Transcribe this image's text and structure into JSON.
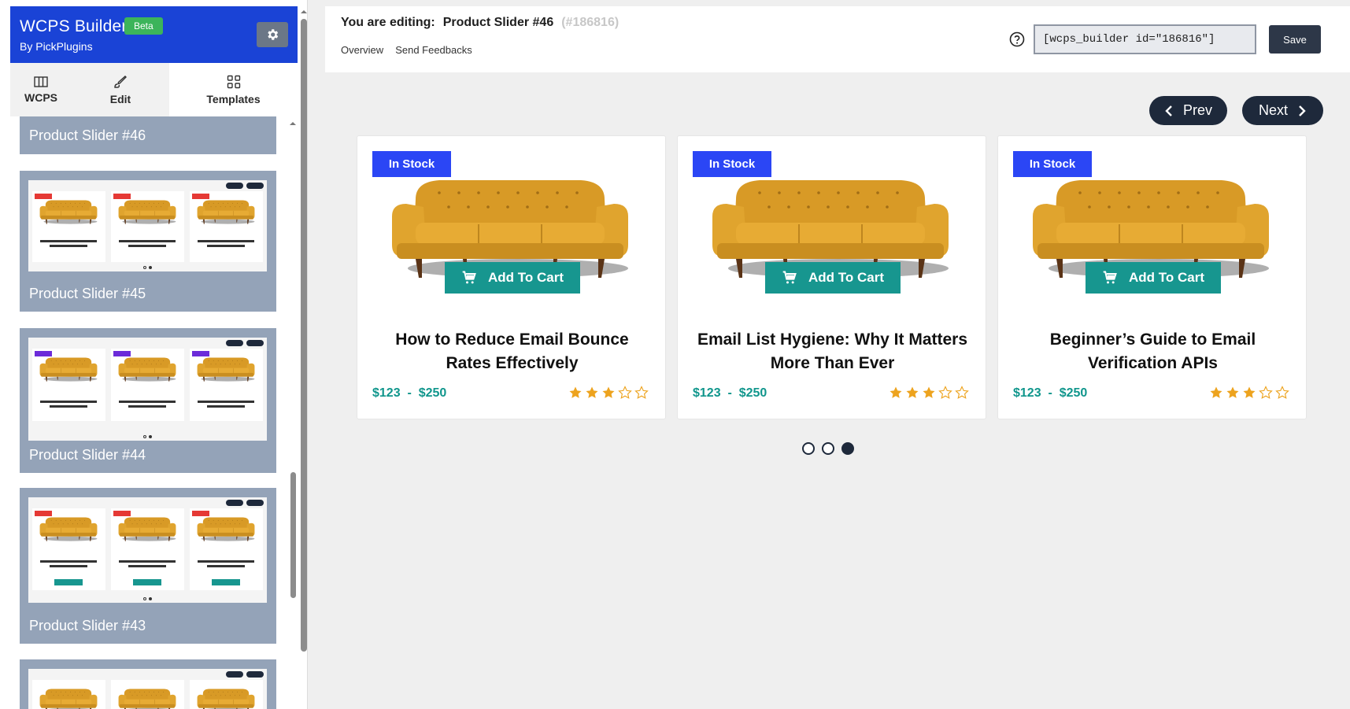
{
  "sidebar": {
    "title": "WCPS Builder",
    "badge": "Beta",
    "subtitle": "By PickPlugins",
    "tabs": [
      {
        "label": "WCPS",
        "icon": "columns-icon"
      },
      {
        "label": "Edit",
        "icon": "brush-icon"
      },
      {
        "label": "Templates",
        "icon": "grid-icon"
      }
    ],
    "active_tab": "Templates",
    "templates": [
      {
        "label": "Product Slider #46"
      },
      {
        "label": "Product Slider #45"
      },
      {
        "label": "Product Slider #44"
      },
      {
        "label": "Product Slider #43"
      },
      {
        "label": ""
      }
    ]
  },
  "topbar": {
    "editing_prefix": "You are editing:",
    "editing_name": "Product Slider #46",
    "editing_id": "(#186816)",
    "links": [
      "Overview",
      "Send Feedbacks"
    ],
    "shortcode": "[wcps_builder id=\"186816\"]",
    "save_label": "Save"
  },
  "slider": {
    "prev_label": "Prev",
    "next_label": "Next",
    "products": [
      {
        "badge": "In Stock",
        "cart_label": "Add To Cart",
        "title": "How to Reduce Email Bounce Rates Effectively",
        "price": "$123  -  $250",
        "rating": 3,
        "max_rating": 5
      },
      {
        "badge": "In Stock",
        "cart_label": "Add To Cart",
        "title": "Email List Hygiene: Why It Matters More Than Ever",
        "price": "$123  -  $250",
        "rating": 3,
        "max_rating": 5
      },
      {
        "badge": "In Stock",
        "cart_label": "Add To Cart",
        "title": "Beginner’s Guide to Email Verification APIs",
        "price": "$123  -  $250",
        "rating": 3,
        "max_rating": 5
      }
    ],
    "pages": 3,
    "active_page": 3
  },
  "colors": {
    "header_blue": "#1a43d6",
    "badge_blue": "#2b46f5",
    "cart_teal": "#17968f",
    "price_teal": "#10968c",
    "star_gold": "#eda31e",
    "card_slate": "#94a3b8",
    "nav_dark": "#1e293b"
  }
}
